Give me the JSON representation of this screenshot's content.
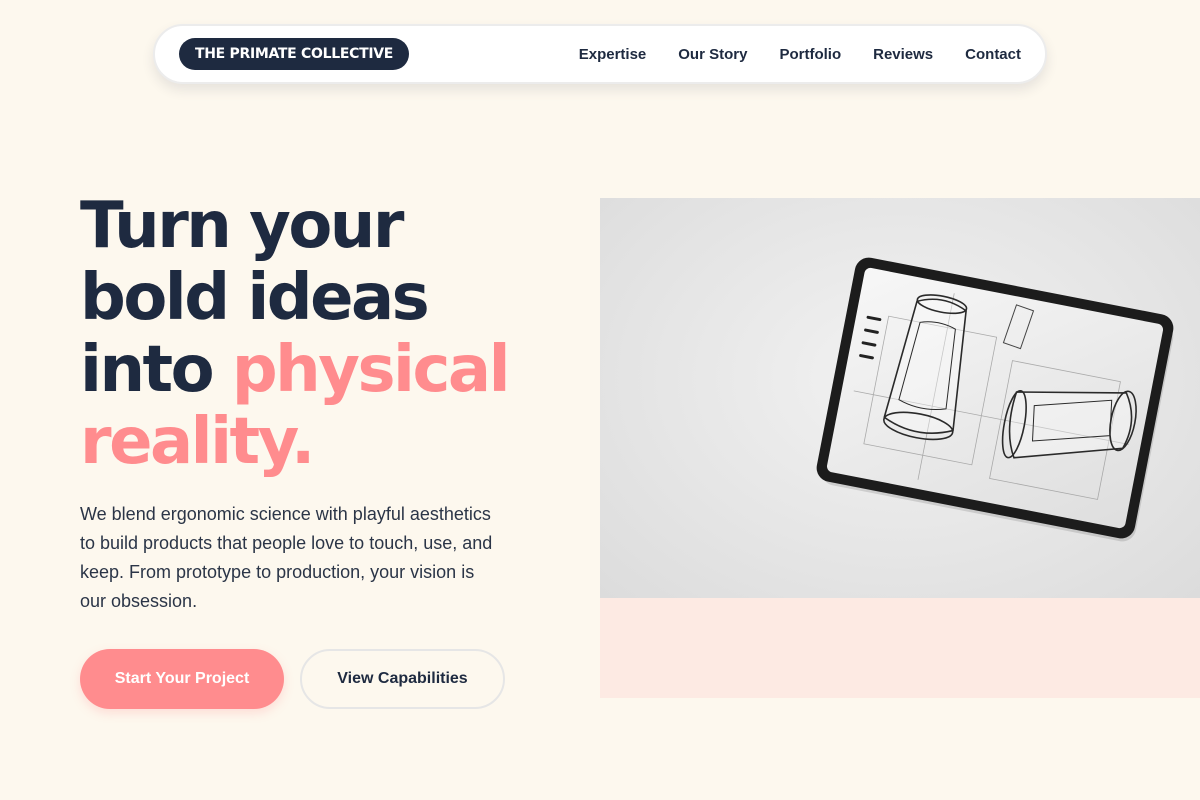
{
  "nav": {
    "brand": "THE PRIMATE COLLECTIVE",
    "links": [
      "Expertise",
      "Our Story",
      "Portfolio",
      "Reviews",
      "Contact"
    ]
  },
  "hero": {
    "headline_line1": "Turn your",
    "headline_line2": "bold ideas",
    "headline_line3_a": "into ",
    "headline_line3_b": "physical",
    "headline_line4": "reality.",
    "subtext": "We blend ergonomic science with playful aesthetics to build products that people love to touch, use, and keep. From prototype to production, your vision is our obsession.",
    "primary_cta": "Start Your Project",
    "secondary_cta": "View Capabilities"
  },
  "colors": {
    "navy": "#1e2a40",
    "coral": "#ff8c8e",
    "cream": "#fdf8ee",
    "blush": "#fdeae3"
  },
  "media": {
    "icon": "tablet-sketch-illustration"
  }
}
